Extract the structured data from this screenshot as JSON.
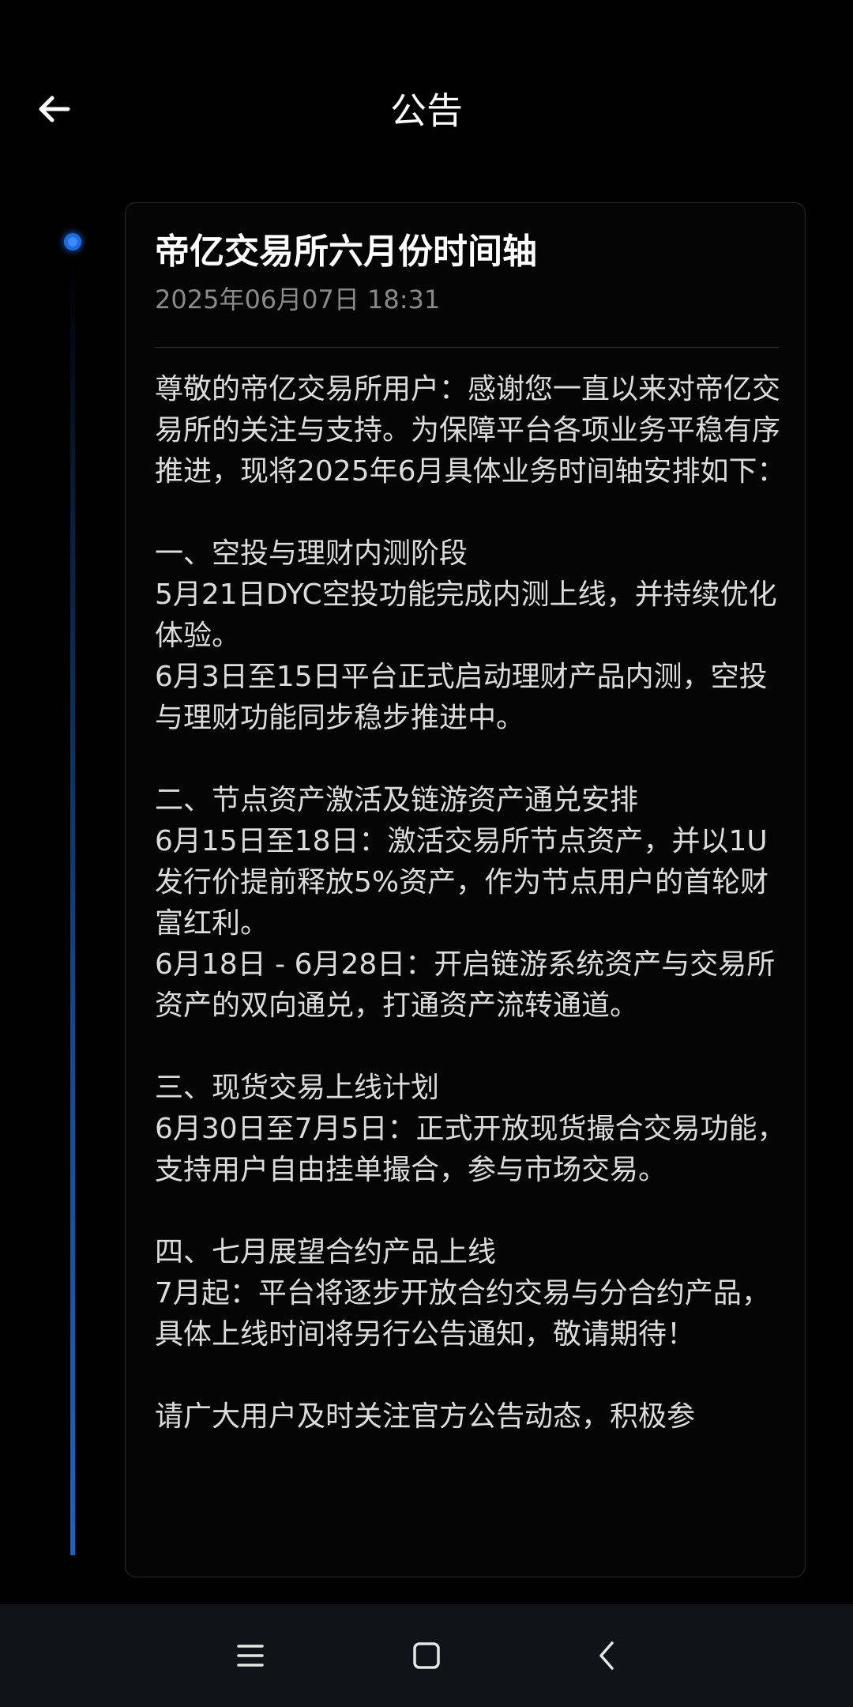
{
  "header": {
    "title": "公告",
    "back_icon": "arrow-left-icon"
  },
  "announcement": {
    "title": "帝亿交易所六月份时间轴",
    "date": "2025年06月07日 18:31",
    "paragraphs": [
      "尊敬的帝亿交易所用户：感谢您一直以来对帝亿交易所的关注与支持。为保障平台各项业务平稳有序推进，现将2025年6月具体业务时间轴安排如下：",
      "",
      "一、空投与理财内测阶段",
      "5月21日DYC空投功能完成内测上线，并持续优化体验。",
      "6月3日至15日平台正式启动理财产品内测，空投与理财功能同步稳步推进中。",
      "",
      "二、节点资产激活及链游资产通兑安排",
      "6月15日至18日：激活交易所节点资产，并以1U发行价提前释放5%资产，作为节点用户的首轮财富红利。",
      "6月18日 - 6月28日：开启链游系统资产与交易所资产的双向通兑，打通资产流转通道。",
      "",
      "三、现货交易上线计划",
      "6月30日至7月5日：正式开放现货撮合交易功能，支持用户自由挂单撮合，参与市场交易。",
      "",
      "四、七月展望合约产品上线",
      "7月起：平台将逐步开放合约交易与分合约产品，具体上线时间将另行公告通知，敬请期待！",
      "",
      "请广大用户及时关注官方公告动态，积极参"
    ]
  },
  "nav_bar": {
    "menu_icon": "menu-icon",
    "home_icon": "home-square-icon",
    "back_icon": "chevron-left-icon"
  },
  "colors": {
    "background": "#000000",
    "accent": "#1e6ae0",
    "date_text": "#8a8a8a",
    "body_text": "#dcdcdc"
  }
}
